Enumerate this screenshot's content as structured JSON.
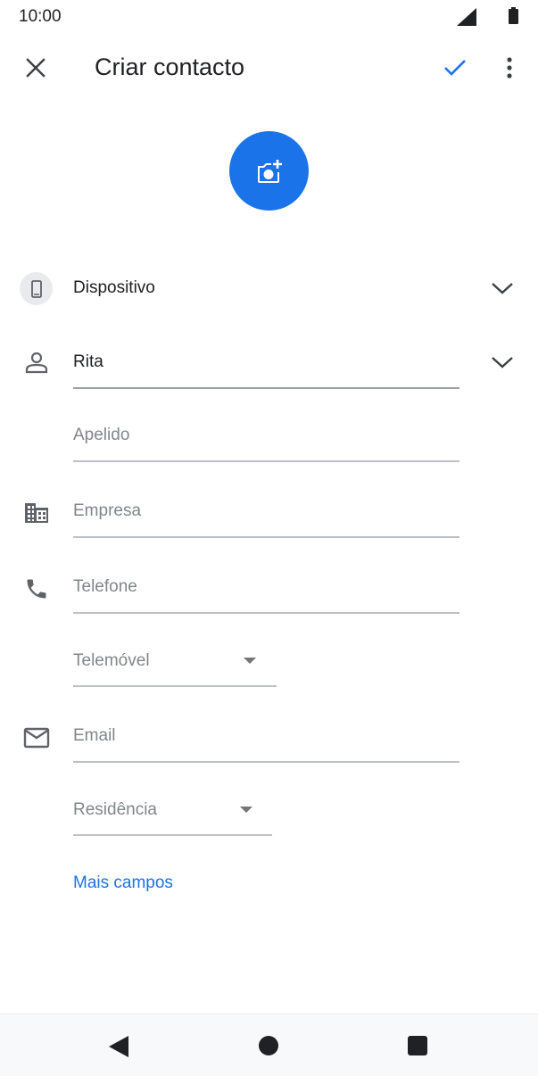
{
  "status_bar": {
    "time": "10:00"
  },
  "app_bar": {
    "title": "Criar contacto"
  },
  "account": {
    "label": "Dispositivo"
  },
  "fields": {
    "first_name": "Rita",
    "last_name_placeholder": "Apelido",
    "company_placeholder": "Empresa",
    "phone_placeholder": "Telefone",
    "phone_type": "Telemóvel",
    "email_placeholder": "Email",
    "email_type": "Residência"
  },
  "more_fields_label": "Mais campos",
  "colors": {
    "accent": "#1a73e8",
    "icon": "#5f6368",
    "text": "#202124",
    "placeholder": "#80868b"
  },
  "icons": [
    "close-icon",
    "check-icon",
    "more-vert-icon",
    "add-photo-icon",
    "phone-device-icon",
    "chevron-down-icon",
    "person-icon",
    "business-icon",
    "phone-icon",
    "email-icon"
  ]
}
